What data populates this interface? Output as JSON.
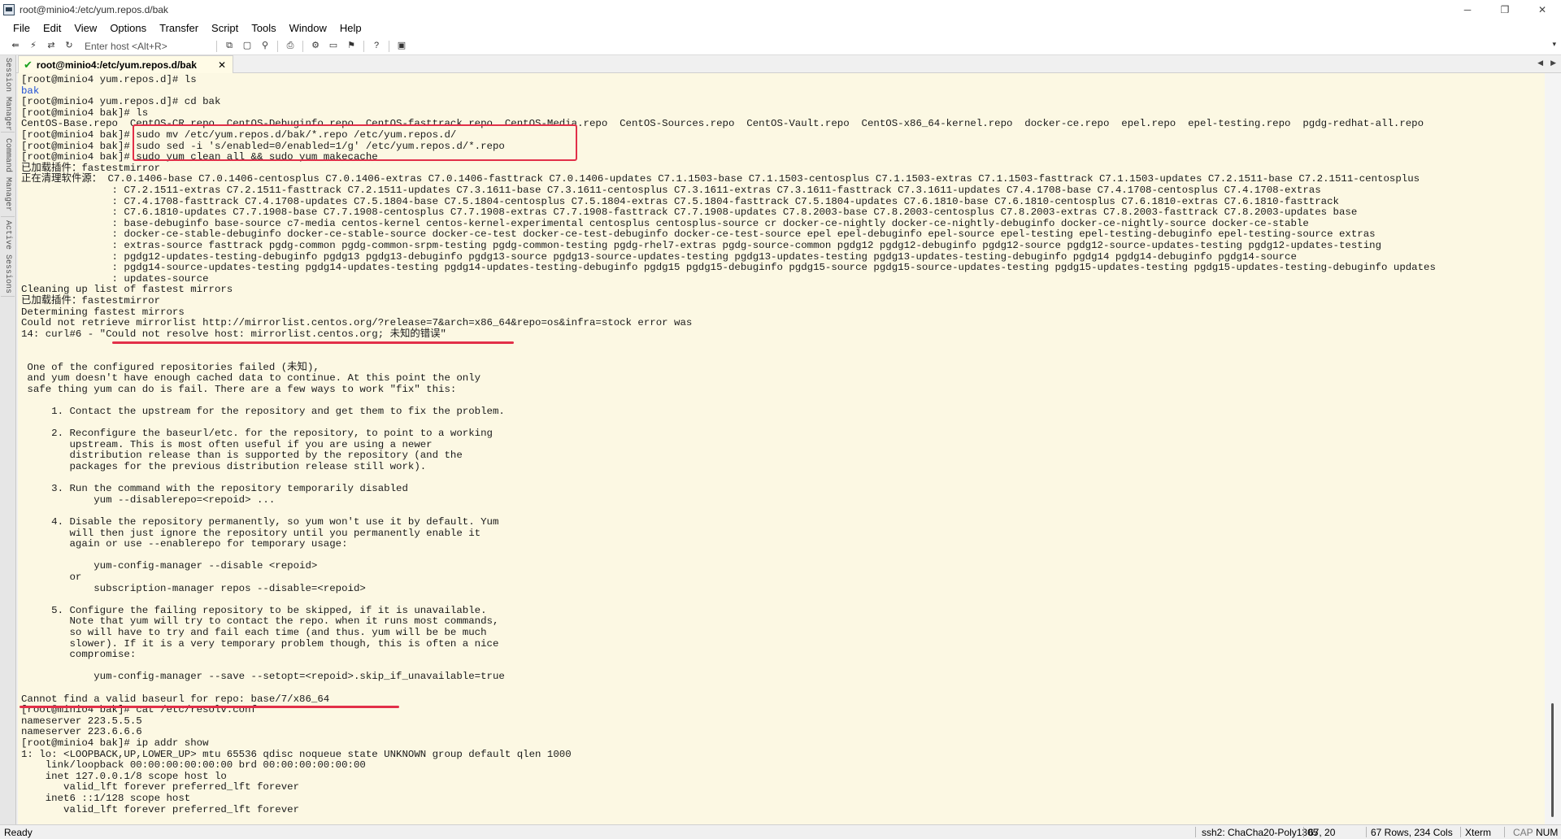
{
  "window": {
    "title": "root@minio4:/etc/yum.repos.d/bak",
    "controls": {
      "minimize": "─",
      "restore": "❐",
      "close": "✕"
    }
  },
  "menu": [
    "File",
    "Edit",
    "View",
    "Options",
    "Transfer",
    "Script",
    "Tools",
    "Window",
    "Help"
  ],
  "toolbar": {
    "host_placeholder": "Enter host <Alt+R>"
  },
  "side_panel": [
    "Session Manager",
    "Command Manager",
    "Active Sessions"
  ],
  "tab": {
    "label": "root@minio4:/etc/yum.repos.d/bak",
    "close": "✕"
  },
  "terminal": {
    "lines": [
      "[root@minio4 yum.repos.d]# ls",
      "bak",
      "[root@minio4 yum.repos.d]# cd bak",
      "[root@minio4 bak]# ls",
      "CentOS-Base.repo  CentOS-CR.repo  CentOS-Debuginfo.repo  CentOS-fasttrack.repo  CentOS-Media.repo  CentOS-Sources.repo  CentOS-Vault.repo  CentOS-x86_64-kernel.repo  docker-ce.repo  epel.repo  epel-testing.repo  pgdg-redhat-all.repo",
      "[root@minio4 bak]# sudo mv /etc/yum.repos.d/bak/*.repo /etc/yum.repos.d/",
      "[root@minio4 bak]# sudo sed -i 's/enabled=0/enabled=1/g' /etc/yum.repos.d/*.repo",
      "[root@minio4 bak]# sudo yum clean all && sudo yum makecache",
      "已加载插件：fastestmirror",
      "正在清理软件源： C7.0.1406-base C7.0.1406-centosplus C7.0.1406-extras C7.0.1406-fasttrack C7.0.1406-updates C7.1.1503-base C7.1.1503-centosplus C7.1.1503-extras C7.1.1503-fasttrack C7.1.1503-updates C7.2.1511-base C7.2.1511-centosplus",
      "               : C7.2.1511-extras C7.2.1511-fasttrack C7.2.1511-updates C7.3.1611-base C7.3.1611-centosplus C7.3.1611-extras C7.3.1611-fasttrack C7.3.1611-updates C7.4.1708-base C7.4.1708-centosplus C7.4.1708-extras",
      "               : C7.4.1708-fasttrack C7.4.1708-updates C7.5.1804-base C7.5.1804-centosplus C7.5.1804-extras C7.5.1804-fasttrack C7.5.1804-updates C7.6.1810-base C7.6.1810-centosplus C7.6.1810-extras C7.6.1810-fasttrack",
      "               : C7.6.1810-updates C7.7.1908-base C7.7.1908-centosplus C7.7.1908-extras C7.7.1908-fasttrack C7.7.1908-updates C7.8.2003-base C7.8.2003-centosplus C7.8.2003-extras C7.8.2003-fasttrack C7.8.2003-updates base",
      "               : base-debuginfo base-source c7-media centos-kernel centos-kernel-experimental centosplus centosplus-source cr docker-ce-nightly docker-ce-nightly-debuginfo docker-ce-nightly-source docker-ce-stable",
      "               : docker-ce-stable-debuginfo docker-ce-stable-source docker-ce-test docker-ce-test-debuginfo docker-ce-test-source epel epel-debuginfo epel-source epel-testing epel-testing-debuginfo epel-testing-source extras",
      "               : extras-source fasttrack pgdg-common pgdg-common-srpm-testing pgdg-common-testing pgdg-rhel7-extras pgdg-source-common pgdg12 pgdg12-debuginfo pgdg12-source pgdg12-source-updates-testing pgdg12-updates-testing",
      "               : pgdg12-updates-testing-debuginfo pgdg13 pgdg13-debuginfo pgdg13-source pgdg13-source-updates-testing pgdg13-updates-testing pgdg13-updates-testing-debuginfo pgdg14 pgdg14-debuginfo pgdg14-source",
      "               : pgdg14-source-updates-testing pgdg14-updates-testing pgdg14-updates-testing-debuginfo pgdg15 pgdg15-debuginfo pgdg15-source pgdg15-source-updates-testing pgdg15-updates-testing pgdg15-updates-testing-debuginfo updates",
      "               : updates-source",
      "Cleaning up list of fastest mirrors",
      "已加载插件：fastestmirror",
      "Determining fastest mirrors",
      "Could not retrieve mirrorlist http://mirrorlist.centos.org/?release=7&arch=x86_64&repo=os&infra=stock error was",
      "14: curl#6 - \"Could not resolve host: mirrorlist.centos.org; 未知的错误\"",
      "",
      "",
      " One of the configured repositories failed (未知),",
      " and yum doesn't have enough cached data to continue. At this point the only",
      " safe thing yum can do is fail. There are a few ways to work \"fix\" this:",
      "",
      "     1. Contact the upstream for the repository and get them to fix the problem.",
      "",
      "     2. Reconfigure the baseurl/etc. for the repository, to point to a working",
      "        upstream. This is most often useful if you are using a newer",
      "        distribution release than is supported by the repository (and the",
      "        packages for the previous distribution release still work).",
      "",
      "     3. Run the command with the repository temporarily disabled",
      "            yum --disablerepo=<repoid> ...",
      "",
      "     4. Disable the repository permanently, so yum won't use it by default. Yum",
      "        will then just ignore the repository until you permanently enable it",
      "        again or use --enablerepo for temporary usage:",
      "",
      "            yum-config-manager --disable <repoid>",
      "        or",
      "            subscription-manager repos --disable=<repoid>",
      "",
      "     5. Configure the failing repository to be skipped, if it is unavailable.",
      "        Note that yum will try to contact the repo. when it runs most commands,",
      "        so will have to try and fail each time (and thus. yum will be be much",
      "        slower). If it is a very temporary problem though, this is often a nice",
      "        compromise:",
      "",
      "            yum-config-manager --save --setopt=<repoid>.skip_if_unavailable=true",
      "",
      "Cannot find a valid baseurl for repo: base/7/x86_64",
      "[root@minio4 bak]# cat /etc/resolv.conf",
      "nameserver 223.5.5.5",
      "nameserver 223.6.6.6",
      "[root@minio4 bak]# ip addr show",
      "1: lo: <LOOPBACK,UP,LOWER_UP> mtu 65536 qdisc noqueue state UNKNOWN group default qlen 1000",
      "    link/loopback 00:00:00:00:00:00 brd 00:00:00:00:00:00",
      "    inet 127.0.0.1/8 scope host lo",
      "       valid_lft forever preferred_lft forever",
      "    inet6 ::1/128 scope host",
      "       valid_lft forever preferred_lft forever"
    ]
  },
  "status": {
    "ready": "Ready",
    "connection": "ssh2: ChaCha20-Poly1305",
    "cursor": "67, 20",
    "size": "67 Rows, 234 Cols",
    "term": "Xterm",
    "cap": "CAP",
    "num": "NUM"
  },
  "colors": {
    "terminal_bg": "#fcf8e3",
    "terminal_text": "#1a1a1a",
    "dir_blue": "#1f4fd6",
    "annotation_red": "#e23049",
    "connected_green": "#19a11e"
  }
}
